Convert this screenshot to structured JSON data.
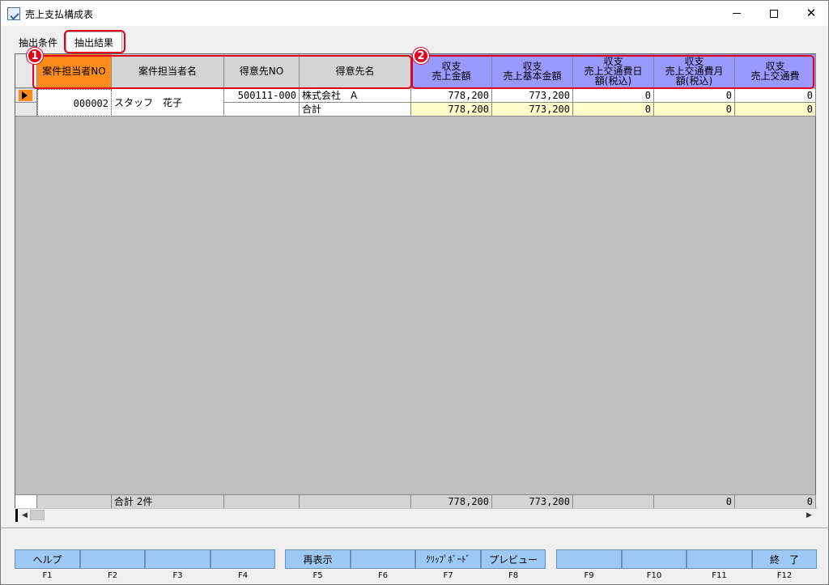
{
  "window": {
    "title": "売上支払構成表",
    "minimize_label": "—",
    "maximize_label": "☐",
    "close_label": "✕"
  },
  "tabs": [
    {
      "label": "抽出条件",
      "active": false
    },
    {
      "label": "抽出結果",
      "active": true
    }
  ],
  "annotations": {
    "badge1": "1",
    "badge2": "2"
  },
  "grid": {
    "columns": [
      "案件担当者NO",
      "案件担当者名",
      "得意先NO",
      "得意先名",
      "収支\n売上金額",
      "収支\n売上基本金額",
      "収支\n売上交通費日\n額(税込)",
      "収支\n売上交通費月\n額(税込)",
      "収支\n売上交通費"
    ],
    "rows": [
      {
        "staff_no": "000002",
        "staff_name": "スタッフ　花子",
        "lines": [
          {
            "client_no": "500111-000",
            "client_name": "株式会社　A",
            "sales": "778,200",
            "base": "773,200",
            "daily": "0",
            "monthly": "0",
            "travel": "0"
          },
          {
            "client_no": "",
            "client_name": "合計",
            "sales": "778,200",
            "base": "773,200",
            "daily": "0",
            "monthly": "0",
            "travel": "0"
          }
        ]
      }
    ],
    "footer": {
      "label": "合計 2件",
      "sales": "778,200",
      "base": "773,200",
      "daily": "",
      "monthly": "0",
      "travel": "0"
    }
  },
  "function_keys": [
    {
      "label": "ヘルプ",
      "key": "F1"
    },
    {
      "label": "",
      "key": "F2"
    },
    {
      "label": "",
      "key": "F3"
    },
    {
      "label": "",
      "key": "F4"
    },
    {
      "label": "再表示",
      "key": "F5"
    },
    {
      "label": "",
      "key": "F6"
    },
    {
      "label": "ｸﾘｯﾌﾟﾎﾞｰﾄﾞ",
      "key": "F7"
    },
    {
      "label": "プレビュー",
      "key": "F8"
    },
    {
      "label": "",
      "key": "F9"
    },
    {
      "label": "",
      "key": "F10"
    },
    {
      "label": "",
      "key": "F11"
    },
    {
      "label": "終　了",
      "key": "F12"
    }
  ],
  "colors": {
    "highlight_red": "#e3001b",
    "header_orange": "#ff8c1a",
    "header_purple": "#9999ff",
    "total_yellow": "#ffffcc",
    "fkey_blue": "#9ec9f5"
  }
}
